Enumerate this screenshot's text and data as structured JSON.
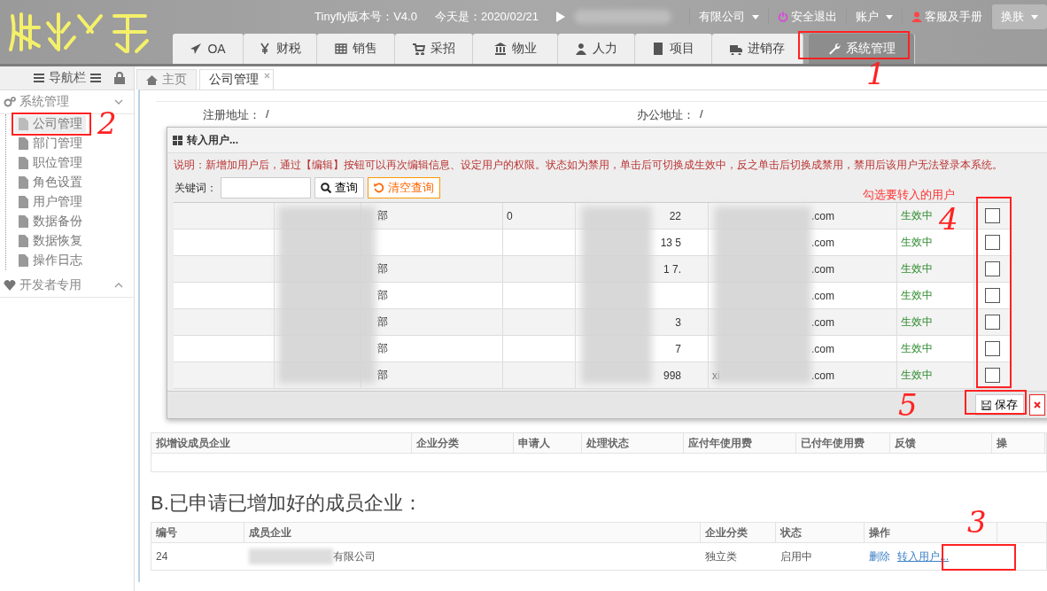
{
  "header": {
    "version": "Tinyfly版本号：V4.0",
    "date": "今天是：2020/02/21",
    "company": "有限公司",
    "logout": "安全退出",
    "account": "账户",
    "help": "客服及手册",
    "skin": "换肤"
  },
  "modules": [
    {
      "label": "OA",
      "selected": false
    },
    {
      "label": "财税",
      "selected": false
    },
    {
      "label": "销售",
      "selected": false
    },
    {
      "label": "采招",
      "selected": false
    },
    {
      "label": "物业",
      "selected": false
    },
    {
      "label": "人力",
      "selected": false
    },
    {
      "label": "项目",
      "selected": false
    },
    {
      "label": "进销存",
      "selected": false
    },
    {
      "label": "系统管理",
      "selected": true
    }
  ],
  "sidebar": {
    "title": "导航栏",
    "groups": [
      {
        "label": "系统管理",
        "expanded": true,
        "children": [
          {
            "label": "公司管理",
            "selected": true
          },
          {
            "label": "部门管理",
            "selected": false
          },
          {
            "label": "职位管理",
            "selected": false
          },
          {
            "label": "角色设置",
            "selected": false
          },
          {
            "label": "用户管理",
            "selected": false
          },
          {
            "label": "数据备份",
            "selected": false
          },
          {
            "label": "数据恢复",
            "selected": false
          },
          {
            "label": "操作日志",
            "selected": false
          }
        ]
      },
      {
        "label": "开发者专用",
        "expanded": false
      }
    ]
  },
  "page_tabs": [
    {
      "label": "主页",
      "selected": false,
      "closable": false
    },
    {
      "label": "公司管理",
      "selected": true,
      "closable": true
    }
  ],
  "form": [
    {
      "label": "注册地址：",
      "value": "/"
    },
    {
      "label": "办公地址：",
      "value": "/"
    }
  ],
  "dialog": {
    "title": "转入用户...",
    "note": "说明：新增加用户后，通过【编辑】按钮可以再次编辑信息、设定用户的权限。状态如为禁用，单击后可切换成生效中，反之单击后切换成禁用，禁用后该用户无法登录本系统。",
    "keyword_label": "关键词：",
    "search_button": "查询",
    "clear_button": "清空查询",
    "save_button": "保存",
    "rows": [
      {
        "dept": "部",
        "col4": "0",
        "phone": "22",
        "email": ".com",
        "email_prefix": "",
        "status": "生效中",
        "checked": false
      },
      {
        "dept": "",
        "col4": "",
        "phone": "13 5",
        "email": ".com",
        "email_prefix": "",
        "status": "生效中",
        "checked": false
      },
      {
        "dept": "部",
        "col4": "",
        "phone": "1 7.",
        "email": ".com",
        "email_prefix": "",
        "status": "生效中",
        "checked": false
      },
      {
        "dept": "部",
        "col4": "",
        "phone": "",
        "email": ".com",
        "email_prefix": "",
        "status": "生效中",
        "checked": false
      },
      {
        "dept": "部",
        "col4": "",
        "phone": "3",
        "email": ".com",
        "email_prefix": "",
        "status": "生效中",
        "checked": false
      },
      {
        "dept": "部",
        "col4": "",
        "phone": "7",
        "email": ".com",
        "email_prefix": "",
        "status": "生效中",
        "checked": false
      },
      {
        "dept": "部",
        "col4": "",
        "phone": "998",
        "email": ".com",
        "email_prefix": "xi",
        "status": "生效中",
        "checked": false
      }
    ]
  },
  "table_a": {
    "columns": [
      "拟增设成员企业",
      "企业分类",
      "申请人",
      "处理状态",
      "应付年使用费",
      "已付年使用费",
      "反馈",
      "操"
    ]
  },
  "section_b": {
    "heading": "B.已申请已增加好的成员企业：",
    "columns": [
      "编号",
      "成员企业",
      "企业分类",
      "状态",
      "操作"
    ],
    "rows": [
      {
        "id": "24",
        "company": "有限公司",
        "category": "独立类",
        "status": "启用中",
        "actions": [
          "删除",
          "转入用户..."
        ]
      }
    ]
  },
  "annotations": [
    {
      "text": "1"
    },
    {
      "text": "2"
    },
    {
      "text": "3"
    },
    {
      "text": "4"
    },
    {
      "text": "5"
    }
  ],
  "hint": "勾选要转入的用户"
}
